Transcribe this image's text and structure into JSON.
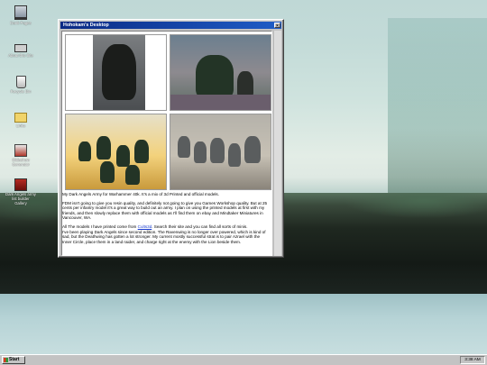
{
  "desktop": {
    "icons": [
      {
        "label": "Dank Pages",
        "icon": "computer-icon"
      },
      {
        "label": "About this Site",
        "icon": "disk-icon"
      },
      {
        "label": "Recycle Bin",
        "icon": "recycle-bin-icon"
      },
      {
        "label": "Links",
        "icon": "folder-icon"
      },
      {
        "label": "Slideshow Generator",
        "icon": "game-icon"
      },
      {
        "label": "Dark Angels army list builder Gallery",
        "icon": "book-icon"
      }
    ]
  },
  "window": {
    "title": "Hohokam's Desktop",
    "close_glyph": "×",
    "post": {
      "p1": "My Dark Angels Army for Warhammer 40k. It's a mix of 3d Printed and official models.",
      "p2": "FDM isn't going to give you resin quality, and definitely not going to give you Games Workshop quality. But at 25 cents per infantry model it's a great way to build out an army. I plan on using the printed models at first with my friends, and then slowly replace them with official models as I'll find them on ebay and Mindtaker Miniatures in Vancouver, WA.",
      "p3_before": "All The models I have printed come from ",
      "p3_link": "Cults3d",
      "p3_after": ". Search their site and you can find all sorts of minis.",
      "p4": "I've been playing Dark Angels since second edition. The Ravenwing is no longer over powered, which is kind of sad, but the Deathwing has gotten a lot stronger. My current mostly successful strat is to pair Azrael with the Inner Circle, place them in a land raider, and charge right at the enemy with the Lion beside them."
    }
  },
  "taskbar": {
    "start_label": "Start",
    "clock": "3:38 AM"
  },
  "colors": {
    "title_bar": "#0a2a84",
    "window_gray": "#c3c3c3",
    "link": "#1a3ccf"
  }
}
